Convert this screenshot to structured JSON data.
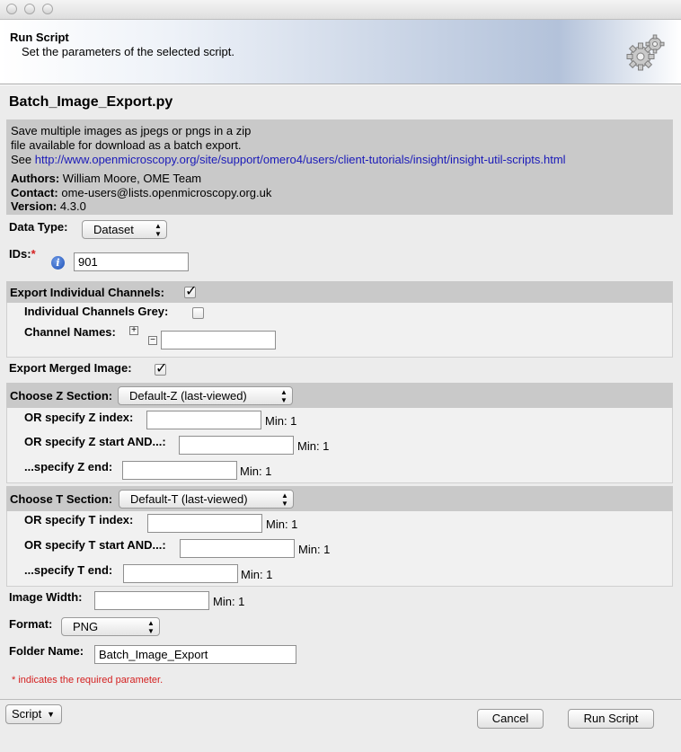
{
  "header": {
    "title": "Run Script",
    "subtitle": "Set the parameters of the selected script."
  },
  "script": {
    "name": "Batch_Image_Export.py",
    "description_lines": [
      "Save multiple images as jpegs or pngs in a zip",
      "file available for download as a batch export."
    ],
    "see_label": "See",
    "see_link": "http://www.openmicroscopy.org/site/support/omero4/users/client-tutorials/insight/insight-util-scripts.html",
    "authors_label": "Authors:",
    "authors": "William Moore, OME Team",
    "contact_label": "Contact:",
    "contact": "ome-users@lists.openmicroscopy.org.uk",
    "version_label": "Version:",
    "version": "4.3.0"
  },
  "params": {
    "data_type_label": "Data Type:",
    "data_type_value": "Dataset",
    "ids_label": "IDs:",
    "required_star": "*",
    "ids_value": "901",
    "export_channels_label": "Export Individual Channels:",
    "export_channels_checked": true,
    "channels_grey_label": "Individual Channels Grey:",
    "channels_grey_checked": false,
    "channel_names_label": "Channel Names:",
    "channel_names_value": "",
    "export_merged_label": "Export Merged Image:",
    "export_merged_checked": true,
    "z_section_label": "Choose Z Section:",
    "z_section_value": "Default-Z (last-viewed)",
    "z_index_label": "OR specify Z index:",
    "z_index_min": "Min: 1",
    "z_start_label": "OR specify Z start AND...:",
    "z_start_min": "Min: 1",
    "z_end_label": "...specify Z end:",
    "z_end_min": "Min: 1",
    "t_section_label": "Choose T Section:",
    "t_section_value": "Default-T (last-viewed)",
    "t_index_label": "OR specify T index:",
    "t_index_min": "Min: 1",
    "t_start_label": "OR specify T start AND...:",
    "t_start_min": "Min: 1",
    "t_end_label": "...specify T end:",
    "t_end_min": "Min: 1",
    "image_width_label": "Image Width:",
    "image_width_min": "Min: 1",
    "format_label": "Format:",
    "format_value": "PNG",
    "folder_name_label": "Folder Name:",
    "folder_name_value": "Batch_Image_Export",
    "required_note": "* indicates the required parameter."
  },
  "footer": {
    "script_menu_label": "Script",
    "cancel_label": "Cancel",
    "run_label": "Run Script"
  },
  "icons": {
    "gear": "gear-icon",
    "info": "info-icon",
    "check": "✓",
    "arrow_up": "▲",
    "arrow_down": "▼",
    "plus": "+",
    "minus": "−"
  },
  "colors": {
    "header_gradient": "#b3c2da",
    "description_bg": "#c9c9c9",
    "link": "#1a1ab8",
    "required": "#d42020"
  }
}
